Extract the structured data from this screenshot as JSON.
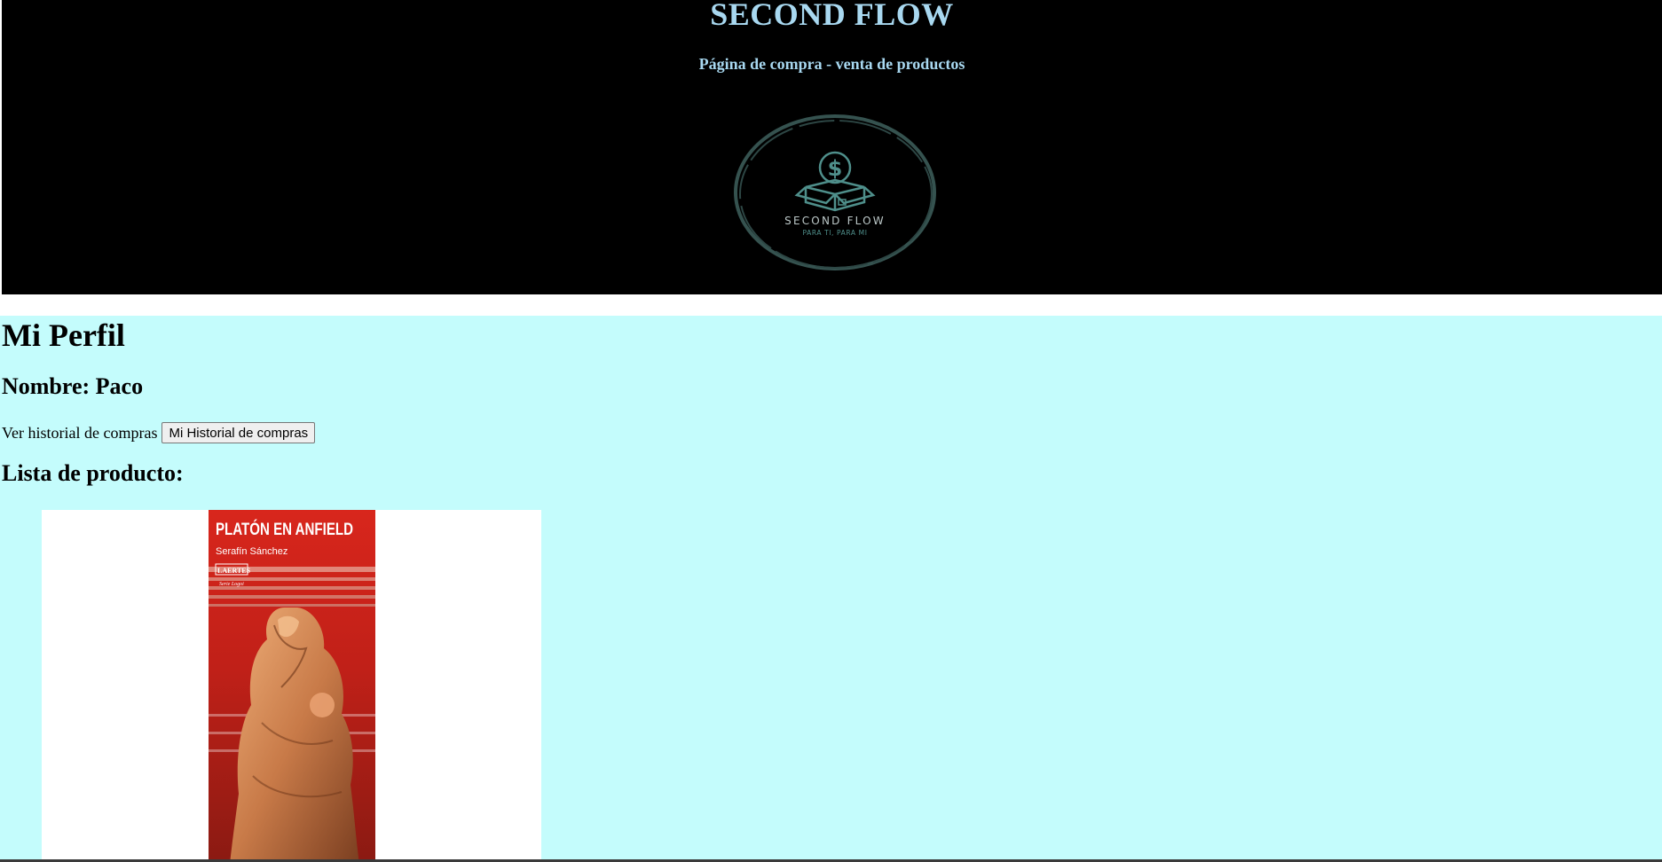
{
  "header": {
    "title": "SECOND FLOW",
    "subtitle": "Página de compra - venta de productos",
    "logo": {
      "brand_text": "SECOND FLOW",
      "tagline": "PARA TI, PARA MI",
      "icon": "money-box-icon"
    }
  },
  "profile": {
    "heading": "Mi Perfil",
    "name_line": "Nombre: Paco",
    "history_label": "Ver historial de compras",
    "history_button": "Mi Historial de compras",
    "list_heading": "Lista de producto:"
  },
  "products": [
    {
      "cover_title": "PLATÓN EN ANFIELD",
      "author": "Serafín Sánchez",
      "publisher": "LAERTES",
      "series": "Serie Logoi"
    }
  ],
  "colors": {
    "header_bg": "#000000",
    "header_text": "#a8d8f0",
    "main_bg": "#c4fcfc",
    "cover_red": "#d8261c"
  }
}
